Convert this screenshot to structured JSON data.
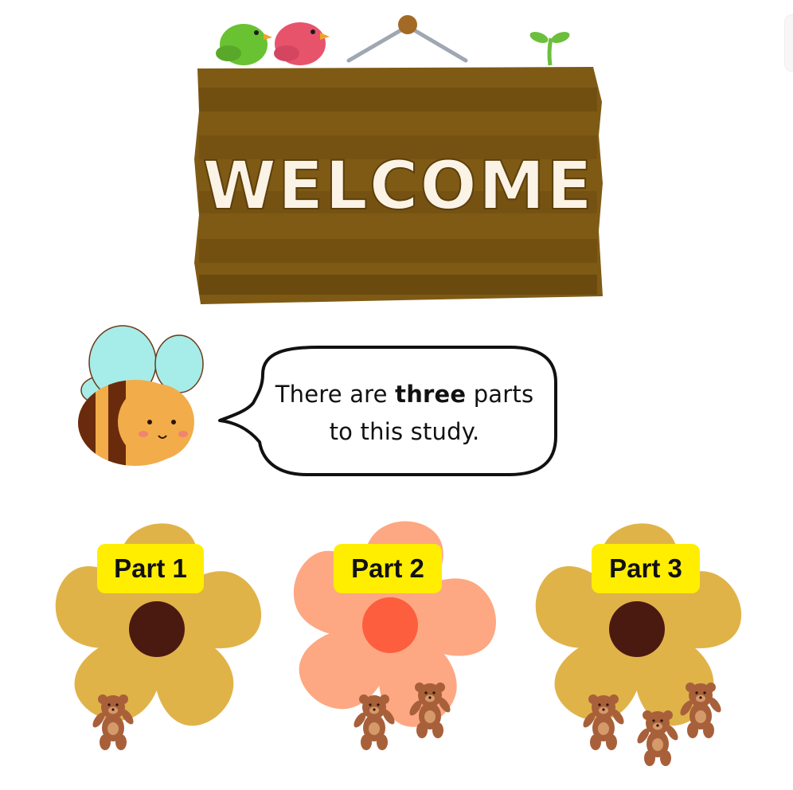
{
  "sign": {
    "text": "WELCOME"
  },
  "speech": {
    "prefix": "There are ",
    "emphasis": "three",
    "suffix": " parts",
    "line2": "to this study."
  },
  "parts": [
    {
      "label": "Part 1",
      "petal_color": "#e0b349",
      "center_color": "#4a1a10",
      "bears": 1
    },
    {
      "label": "Part 2",
      "petal_color": "#fda883",
      "center_color": "#fd5e3d",
      "bears": 2
    },
    {
      "label": "Part 3",
      "petal_color": "#e0b349",
      "center_color": "#4a1a10",
      "bears": 3
    }
  ],
  "colors": {
    "label_bg": "#ffee00",
    "sign_wood": "#7f5a14",
    "sign_wood_dark": "#6b4a0e",
    "sign_text": "#fbf3e6",
    "bird_green": "#69c232",
    "bird_pink": "#e8536c",
    "bee_wing": "#a6ece8",
    "bee_body": "#f2ac4a",
    "bee_stripe": "#6a2b0c",
    "bear": "#a8603a"
  },
  "icons": [
    "bird-icon",
    "sprout-icon",
    "bee-icon",
    "bear-icon",
    "flower-icon"
  ]
}
